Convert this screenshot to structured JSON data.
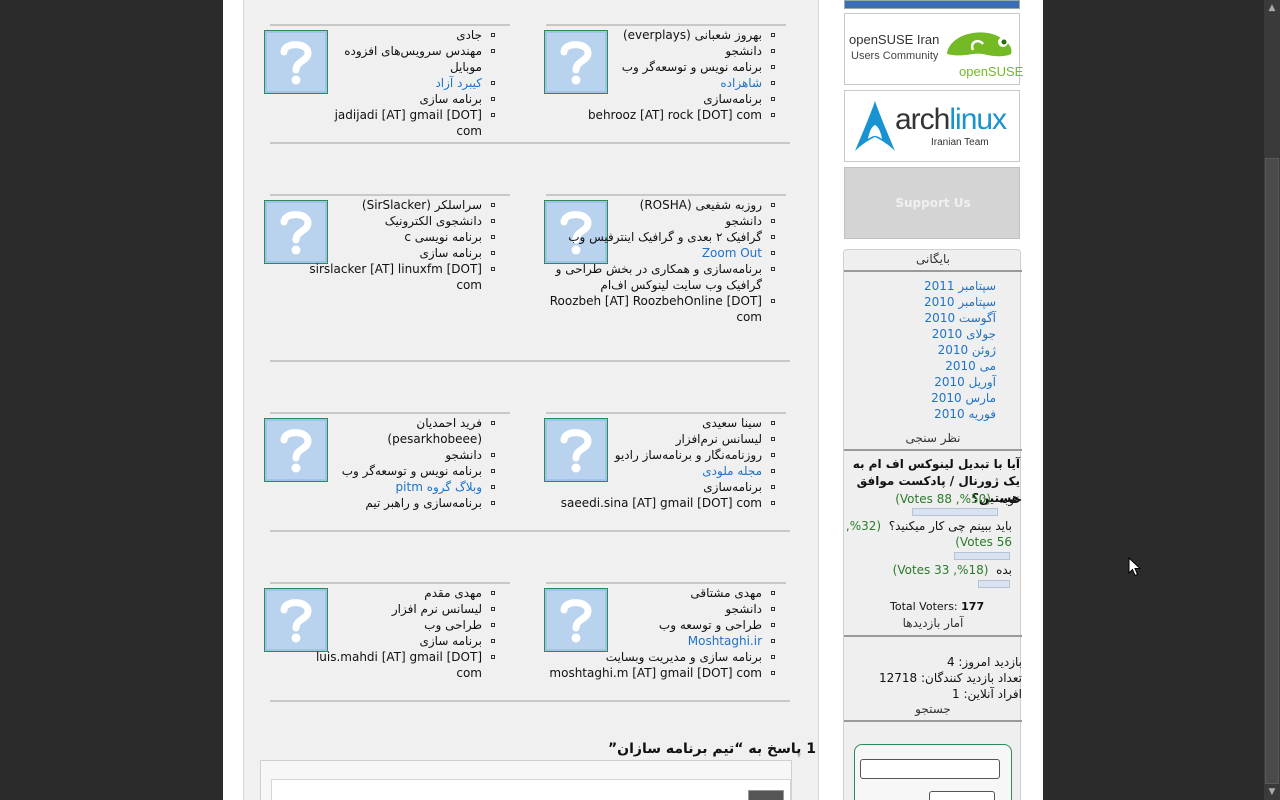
{
  "team": [
    {
      "lines": [
        "بهروز شعبانی (everplays)",
        "دانشجو",
        "برنامه نویس و توسعه‌گر وب",
        "شاهزاده",
        "برنامه‌سازی",
        "behrooz [AT] rock [DOT] com"
      ]
    },
    {
      "lines": [
        "جادی",
        "مهندس سرویس‌های افزوده موبایل",
        "کیبرد آزاد",
        "برنامه سازی",
        "jadijadi [AT] gmail [DOT] com"
      ]
    },
    {
      "lines": [
        "روزبه شفیعی (ROSHA)",
        "دانشجو",
        "گرافیک ۲ بعدی و گرافیک اینترفیس وب",
        "Zoom Out",
        "برنامه‌سازی و همکاری در بخش طراحی و گرافیک وب سایت لینوکس اف‌ام",
        "Roozbeh [AT] RoozbehOnline [DOT] com"
      ]
    },
    {
      "lines": [
        "سراسلکر (SirSlacker)",
        "دانشجوی الکترونیک",
        "برنامه نویسی c",
        "برنامه سازی",
        "sirslacker [AT] linuxfm [DOT] com"
      ]
    },
    {
      "lines": [
        "سینا سعیدی",
        "لیسانس نرم‌افزار",
        "روزنامه‌نگار و برنامه‌ساز رادیو",
        "مجله ملودی",
        "برنامه‌سازی",
        "saeedi.sina [AT] gmail [DOT] com"
      ]
    },
    {
      "lines": [
        "فرید احمدیان (pesarkhobeee)",
        "دانشجو",
        "برنامه نویس و توسعه‌گر وب",
        "وبلاگ گروه pitm",
        "برنامه‌سازی و راهبر تیم"
      ]
    },
    {
      "lines": [
        "مهدی مشتاقی",
        "دانشجو",
        "طراحی و توسعه وب",
        "Moshtaghi.ir",
        "برنامه سازی و مدیریت وبسایت",
        "moshtaghi.m [AT] gmail [DOT] com"
      ]
    },
    {
      "lines": [
        "مهدی مقدم",
        "لیسانس نرم افزار",
        "طراحی وب",
        "برنامه سازی",
        "luis.mahdi [AT] gmail [DOT] com"
      ]
    }
  ],
  "comments": {
    "title": "1 پاسخ به “تیم برنامه سازان”"
  },
  "sidebar": {
    "opensuse": {
      "line1": "openSUSE Iran",
      "line2": "Users Community",
      "brand": "openSUSE"
    },
    "arch": {
      "brand_a": "arch",
      "brand_b": "linux",
      "sub": "Iranian Team"
    },
    "support": "Support Us",
    "archive": {
      "title": "بایگانی",
      "items": [
        "سپتامبر 2011",
        "سپتامبر 2010",
        "آگوست 2010",
        "جولای 2010",
        "ژوئن 2010",
        "می 2010",
        "آوریل 2010",
        "مارس 2010",
        "فوریه 2010"
      ]
    },
    "poll": {
      "title": "نظر سنجی",
      "question": "آیا با تبدیل لینوکس اف ام به یک ژورنال / پادکست موافق هستین؟",
      "options": [
        {
          "label": "خوبه",
          "result": "(50%, 88 Votes)",
          "pct": 50
        },
        {
          "label": "باید ببینم چی کار میکنید؟",
          "result": "(32%, 56 Votes)",
          "pct": 32
        },
        {
          "label": "بده",
          "result": "(18%, 33 Votes)",
          "pct": 18
        }
      ],
      "total_label": "Total Voters:",
      "total_value": "177",
      "stats_link": "آمار بازدیدها"
    },
    "stats": {
      "today": "بازدید امروز: 4",
      "visitors": "تعداد بازدید کنندگان: 12718",
      "online": "افراد آنلاین: 1"
    },
    "search": {
      "title": "جستجو",
      "placeholder": ""
    }
  },
  "colors": {
    "link": "#1e73c9",
    "vote_green": "#2a7a2a",
    "avatar_blue": "#9fc4e8"
  },
  "icons": {
    "avatar": "question-mark-icon",
    "cursor": "mouse-pointer-icon"
  }
}
